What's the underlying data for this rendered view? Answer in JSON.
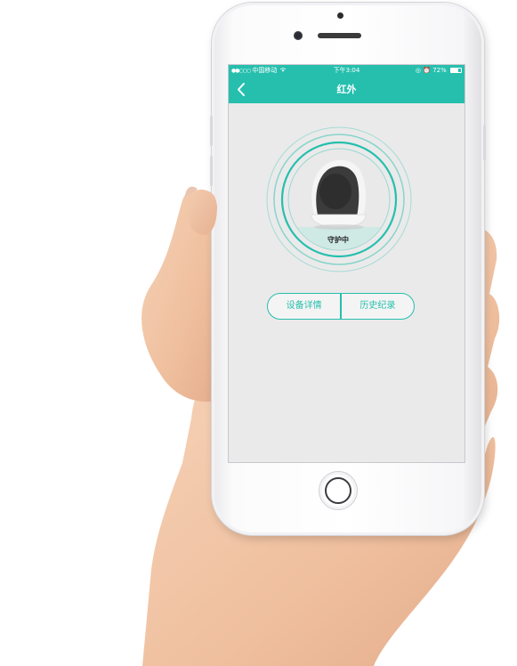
{
  "statusbar": {
    "carrier": "中国移动",
    "time": "下午3:04",
    "battery_percent": "72%",
    "battery_level": 0.72
  },
  "navbar": {
    "title": "红外",
    "back_icon": "chevron-left-icon"
  },
  "device": {
    "status_text": "守护中"
  },
  "actions": {
    "device_details": "设备详情",
    "history": "历史纪录"
  },
  "colors": {
    "accent": "#26bfae",
    "screen_bg": "#eaeaea",
    "skin": "#f2c7a6"
  }
}
